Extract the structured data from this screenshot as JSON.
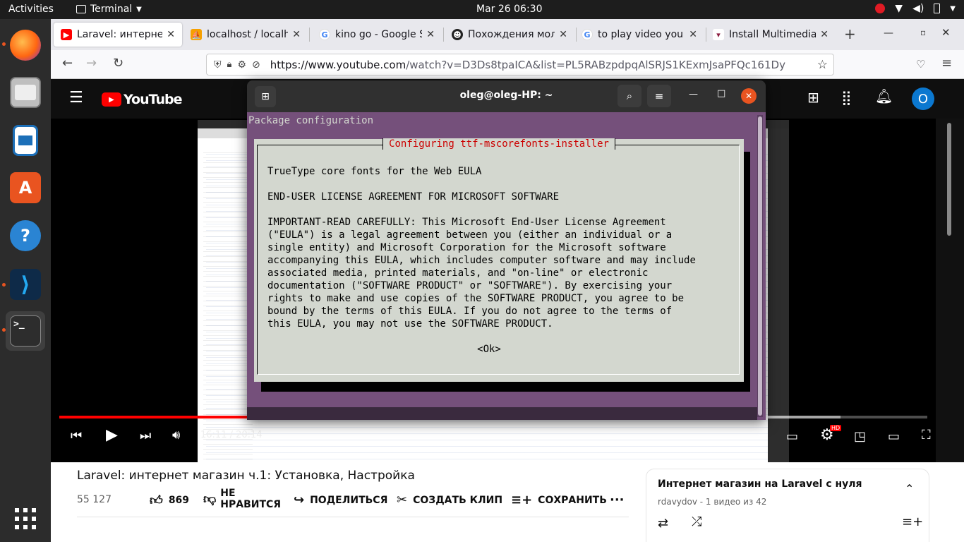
{
  "topbar": {
    "activities": "Activities",
    "app_name": "Terminal",
    "clock": "Mar 26  06:30"
  },
  "dock": {
    "items": [
      "firefox-icon",
      "files-icon",
      "writer-icon",
      "software-icon",
      "help-icon",
      "vscode-icon",
      "terminal-icon",
      "apps-grid-icon"
    ]
  },
  "browser": {
    "tabs": [
      {
        "label": "Laravel: интернет м",
        "favicon": "youtube-icon",
        "active": true
      },
      {
        "label": "localhost / localhos",
        "favicon": "phpmyadmin-icon",
        "active": false
      },
      {
        "label": "kino go - Google Se",
        "favicon": "google-icon",
        "active": false
      },
      {
        "label": "Похождения моло",
        "favicon": "face-icon",
        "active": false
      },
      {
        "label": "to play video you m",
        "favicon": "google-icon",
        "active": false
      },
      {
        "label": "Install Multimedia C",
        "favicon": "ubuntu-icon",
        "active": false
      }
    ],
    "url_host": "https://www.youtube.com",
    "url_path": "/watch?v=D3Ds8tpaICA&list=PL5RABzpdpqAlSRJS1KExmJsaPFQc161Dy"
  },
  "youtube": {
    "logo": "YouTube",
    "avatar_letter": "O",
    "time": "16:11 / 20:14",
    "progress": 0.8,
    "title": "Laravel: интернет магазин ч.1: Установка, Настройка",
    "views": "55 127",
    "likes": "869",
    "dislike": "НЕ НРАВИТСЯ",
    "share": "ПОДЕЛИТЬСЯ",
    "clip": "СОЗДАТЬ КЛИП",
    "save": "СОХРАНИТЬ",
    "playlist_title": "Интернет магазин на Laravel с нуля",
    "playlist_meta": "rdavydov - 1 видео из 42",
    "hd_badge": "HD"
  },
  "terminal": {
    "title": "oleg@oleg-HP: ~",
    "package_configuration": "Package configuration",
    "dialog_title": "Configuring ttf-mscorefonts-installer",
    "eula_title": "TrueType core fonts for the Web EULA",
    "eula_heading": "END-USER LICENSE AGREEMENT FOR MICROSOFT SOFTWARE",
    "eula_lines": [
      "IMPORTANT-READ CAREFULLY: This Microsoft End-User License Agreement",
      "(\"EULA\") is a legal agreement between you (either an individual or a",
      "single entity) and Microsoft Corporation for the Microsoft software",
      "accompanying this EULA, which includes computer software and may include",
      "associated media, printed materials, and \"on-line\" or electronic",
      "documentation (\"SOFTWARE PRODUCT\" or \"SOFTWARE\"). By exercising your",
      "rights to make and use copies of the SOFTWARE PRODUCT, you agree to be",
      "bound by the terms of this EULA. If you do not agree to the terms of",
      "this EULA, you may not use the SOFTWARE PRODUCT."
    ],
    "ok_button": "<Ok>"
  },
  "colors": {
    "terminal_bg": "#75507b",
    "dialog_bg": "#d3d7cf",
    "dialog_title": "#cc0000",
    "yt_red": "#ff0000"
  }
}
